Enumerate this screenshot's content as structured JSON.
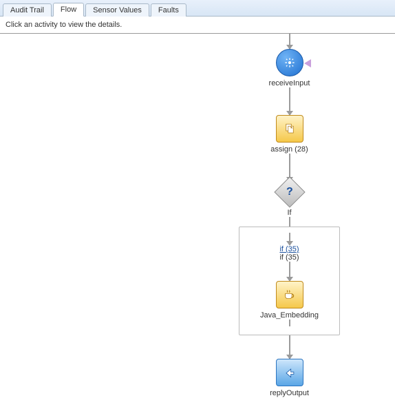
{
  "tabs": {
    "audit_trail": "Audit Trail",
    "flow": "Flow",
    "sensor_values": "Sensor Values",
    "faults": "Faults"
  },
  "hint": "Click an activity to view the details.",
  "nodes": {
    "receive": {
      "label": "receiveInput",
      "icon": "gear-icon"
    },
    "assign": {
      "label": "assign (28)",
      "icon": "document-copy-icon"
    },
    "if_gateway": {
      "label": "If",
      "glyph": "?"
    },
    "if_branch": {
      "link_label": "if (35)",
      "label": "if (35)"
    },
    "java": {
      "label": "Java_Embedding",
      "icon": "coffee-cup-icon"
    },
    "reply": {
      "label": "replyOutput",
      "icon": "reply-arrow-icon"
    }
  }
}
